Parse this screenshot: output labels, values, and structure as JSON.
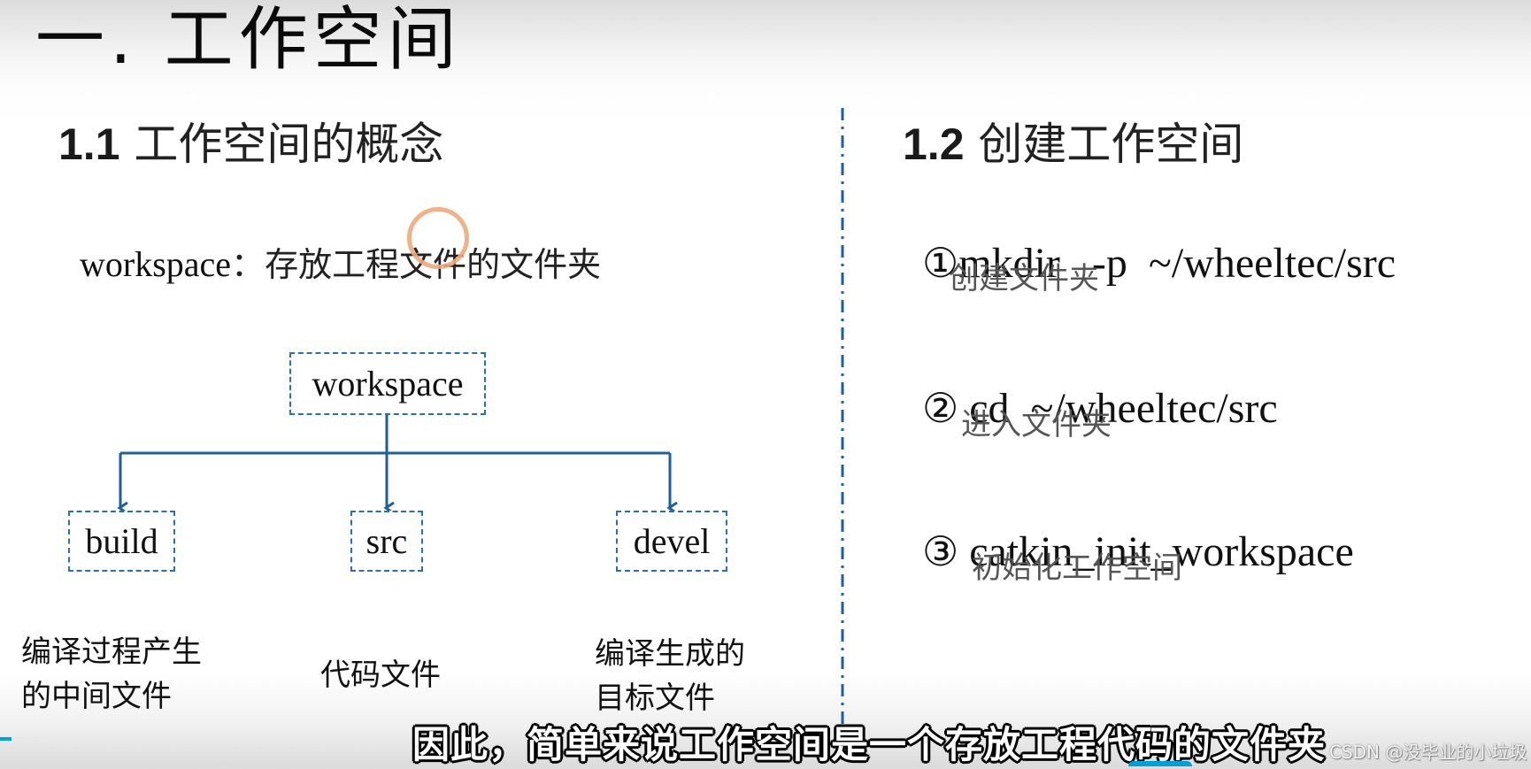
{
  "slide": {
    "title": "一. 工作空间",
    "section_1": {
      "heading_num": "1.1",
      "heading_text": "工作空间的概念",
      "definition_term": "workspace",
      "definition_sep": "：",
      "definition_text": "存放工程文件的文件夹",
      "diagram": {
        "root": "workspace",
        "children": [
          {
            "label": "build",
            "description_lines": [
              "编译过程产生",
              "的中间文件"
            ]
          },
          {
            "label": "src",
            "description_lines": [
              "代码文件"
            ]
          },
          {
            "label": "devel",
            "description_lines": [
              "编译生成的",
              "目标文件"
            ]
          }
        ]
      }
    },
    "section_2": {
      "heading_num": "1.2",
      "heading_text": "创建工作空间",
      "steps": [
        {
          "marker": "①",
          "command": "mkdir   -p  ~/wheeltec/src",
          "note": "创建文件夹"
        },
        {
          "marker": "②",
          "command": " cd  ~/wheeltec/src",
          "note": "进入文件夹"
        },
        {
          "marker": "③",
          "command": " catkin_init_workspace",
          "note": "初始化工作空间"
        }
      ]
    }
  },
  "video": {
    "subtitle": "因此，简单来说工作空间是一个存放工程代码的文件夹",
    "watermark": "CSDN @没毕业的小垃圾",
    "accent_color": "#00a1d6",
    "cursor_ring_color": "#f0a87c",
    "diagram_line_color": "#1f5f9c"
  }
}
